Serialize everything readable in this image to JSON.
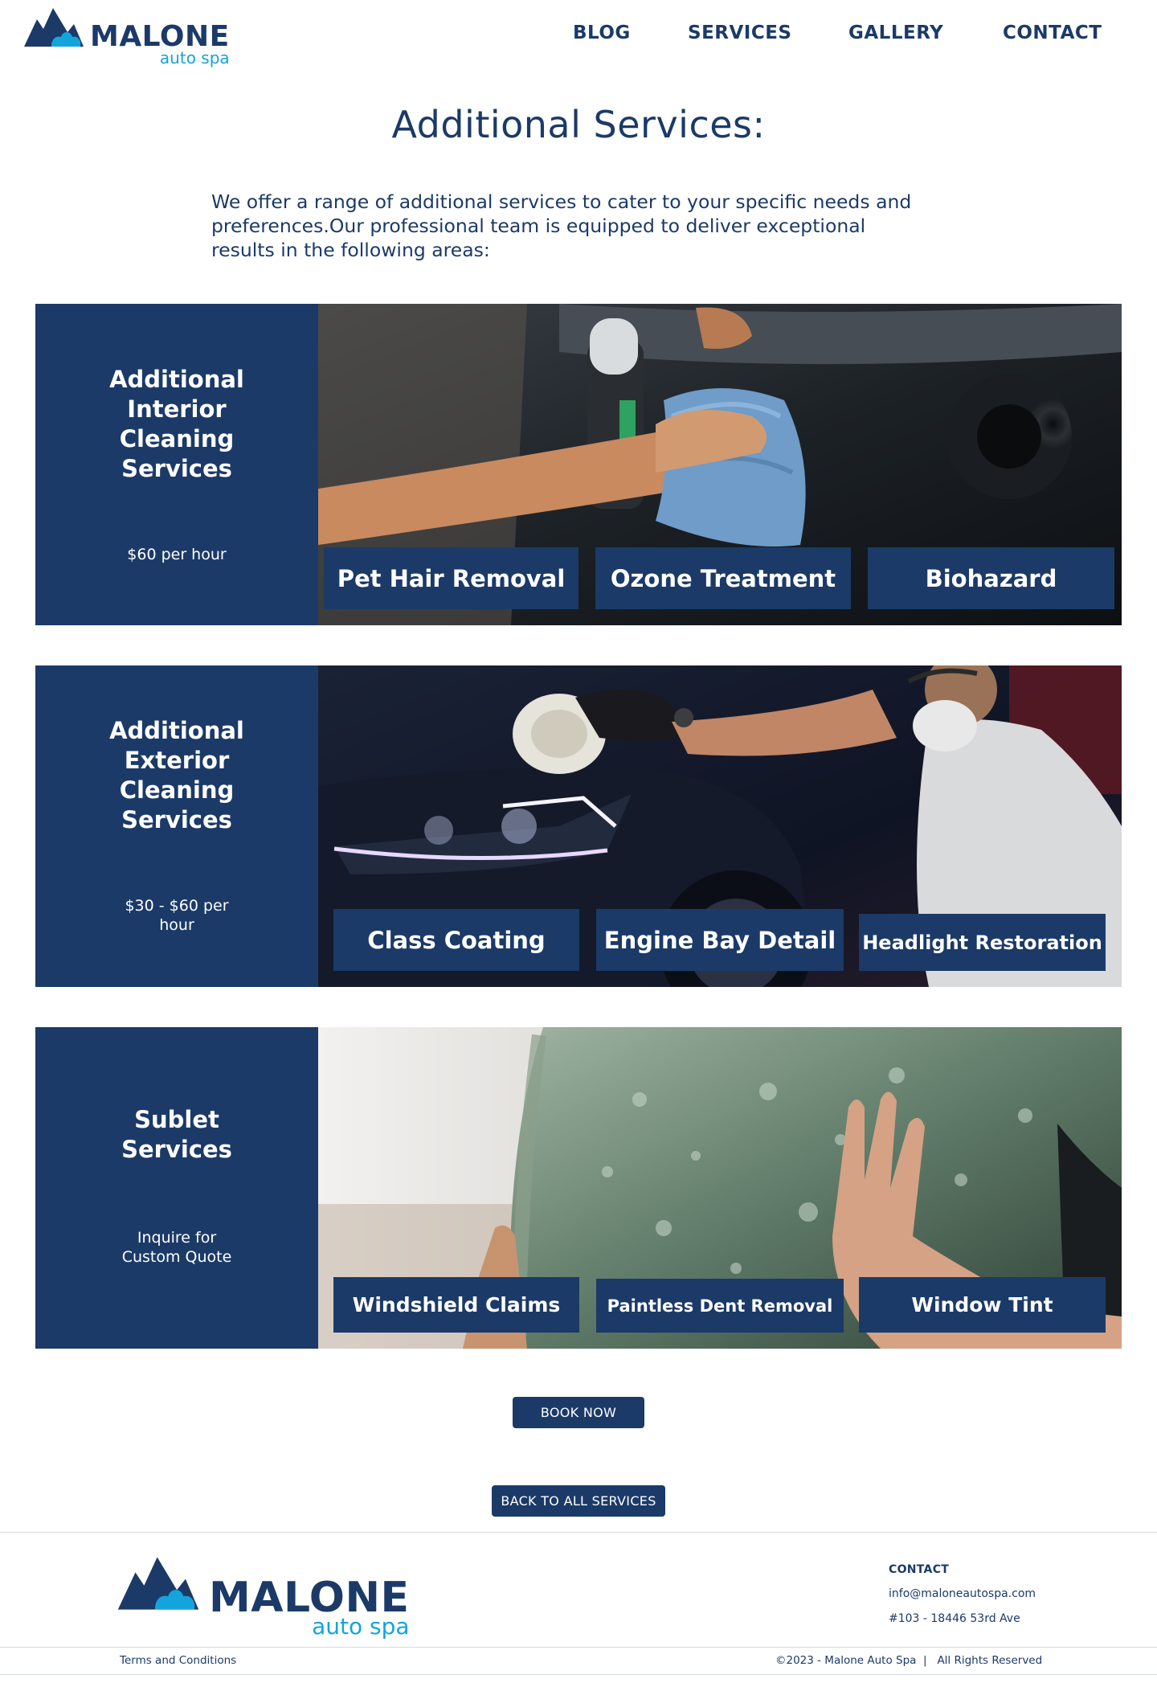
{
  "header": {
    "logo": {
      "name": "MALONE",
      "sub": "auto spa"
    },
    "nav": [
      {
        "label": "BLOG"
      },
      {
        "label": "SERVICES"
      },
      {
        "label": "GALLERY"
      },
      {
        "label": "CONTACT"
      }
    ]
  },
  "main": {
    "title": "Additional Services:",
    "intro": "We offer a range of additional services to cater to your specific needs and preferences.Our professional team is equipped to deliver exceptional results in the following areas:",
    "panels": [
      {
        "title": "Additional Interior Cleaning Services",
        "price": "$60 per hour",
        "image_icon": "interior-cleaning-photo",
        "services": [
          "Pet Hair Removal",
          "Ozone Treatment",
          "Biohazard"
        ]
      },
      {
        "title": "Additional Exterior Cleaning Services",
        "price": "$30 - $60 per hour",
        "image_icon": "exterior-polishing-photo",
        "services": [
          "Class Coating",
          "Engine Bay Detail",
          "Headlight Restoration"
        ]
      },
      {
        "title": "Sublet Services",
        "price": "Inquire for Custom Quote",
        "image_icon": "window-tint-photo",
        "services": [
          "Windshield Claims",
          "Paintless Dent Removal",
          "Window Tint"
        ]
      }
    ],
    "book_button": "BOOK NOW",
    "back_button": "BACK TO ALL SERVICES"
  },
  "footer": {
    "logo": {
      "name": "MALONE",
      "sub": "auto spa"
    },
    "contact_heading": "CONTACT",
    "email": "info@maloneautospa.com",
    "address": "#103 - 18446 53rd Ave",
    "terms": "Terms and Conditions",
    "copyright": "©2023 - Malone Auto Spa  |   All Rights Reserved"
  },
  "colors": {
    "navy": "#1b3a68",
    "accent_blue": "#14a4dc",
    "background": "#ffffff"
  }
}
